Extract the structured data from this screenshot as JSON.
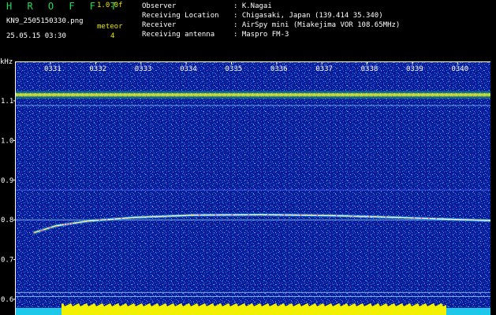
{
  "header": {
    "app_title": "H R O F F T",
    "version": "1.0.0f",
    "filename": "KN9_2505150330.png",
    "datetime": "25.05.15 03:30",
    "mode": "meteor",
    "count": "4"
  },
  "info": [
    {
      "label": "Observer",
      "value": ": K.Nagai"
    },
    {
      "label": "Receiving Location",
      "value": ": Chigasaki, Japan (139.414 35.340)"
    },
    {
      "label": "Receiver",
      "value": ": AirSpy mini (Miakejima VOR 108.65MHz)"
    },
    {
      "label": "Receiving antenna",
      "value": ": Maspro FM-3"
    }
  ],
  "chart_data": {
    "type": "heatmap",
    "ylabel": "kHz",
    "ylim": [
      0.6,
      1.2
    ],
    "yticks": [
      {
        "value": 1.1,
        "label": "1.1"
      },
      {
        "value": 1.0,
        "label": "1.0"
      },
      {
        "value": 0.9,
        "label": "0.9"
      },
      {
        "value": 0.8,
        "label": "0.8"
      },
      {
        "value": 0.7,
        "label": "0.7"
      },
      {
        "value": 0.6,
        "label": "0.6"
      }
    ],
    "time_labels": [
      "0331",
      "0332",
      "0333",
      "0334",
      "0335",
      "0336",
      "0337",
      "0338",
      "0339",
      "0340"
    ],
    "background_color": "#0a1fa0",
    "bands": [
      {
        "freq": 1.115,
        "color": "#c8e830"
      },
      {
        "freq": 1.088,
        "color": "#7ec8ff"
      },
      {
        "freq": 0.875,
        "color": "#4a6cff"
      },
      {
        "freq": 0.8,
        "color": "#9ad8ff"
      },
      {
        "freq": 0.617,
        "color": "#9ad8ff"
      },
      {
        "freq": 0.607,
        "color": "#9ad8ff"
      }
    ],
    "trace": {
      "color": "#ffffff",
      "points": [
        {
          "t": 0.0,
          "f": 0.767
        },
        {
          "t": 0.05,
          "f": 0.785
        },
        {
          "t": 0.12,
          "f": 0.797
        },
        {
          "t": 0.22,
          "f": 0.806
        },
        {
          "t": 0.35,
          "f": 0.812
        },
        {
          "t": 0.5,
          "f": 0.813
        },
        {
          "t": 0.65,
          "f": 0.811
        },
        {
          "t": 0.8,
          "f": 0.806
        },
        {
          "t": 1.0,
          "f": 0.798
        }
      ]
    },
    "bottom_strip": {
      "fill_color": "#f0f000",
      "edge_color": "#1ec8e8"
    }
  }
}
